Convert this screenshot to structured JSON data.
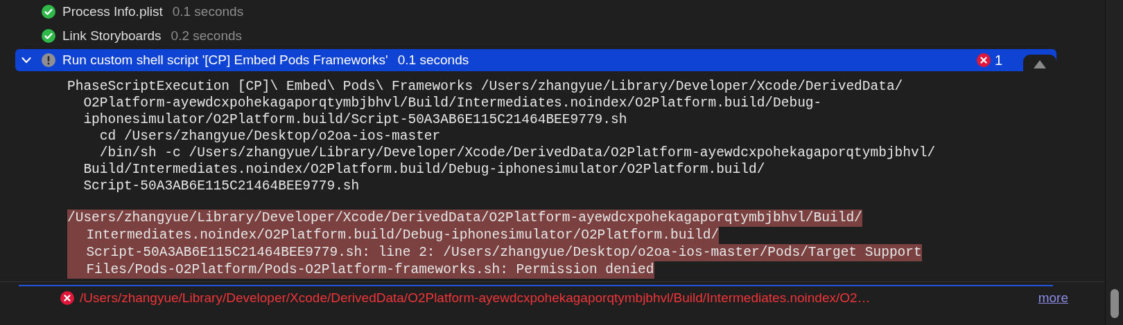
{
  "steps": [
    {
      "label": "Process Info.plist",
      "duration": "0.1 seconds",
      "kind": "success",
      "selected": false
    },
    {
      "label": "Link Storyboards",
      "duration": "0.2 seconds",
      "kind": "success",
      "selected": false
    },
    {
      "label": "Run custom shell script '[CP] Embed Pods Frameworks'",
      "duration": "0.1 seconds",
      "kind": "warning",
      "selected": true,
      "expanded": true,
      "error_count": "1"
    }
  ],
  "command_output": [
    {
      "kind": "command",
      "text": "PhaseScriptExecution [CP]\\ Embed\\ Pods\\ Frameworks /Users/zhangyue/Library/Developer/Xcode/DerivedData/"
    },
    {
      "kind": "continuation",
      "text": "O2Platform-ayewdcxpohekagaporqtymbjbhvl/Build/Intermediates.noindex/O2Platform.build/Debug-"
    },
    {
      "kind": "continuation",
      "text": "iphonesimulator/O2Platform.build/Script-50A3AB6E115C21464BEE9779.sh"
    },
    {
      "kind": "subcommand",
      "text": "cd /Users/zhangyue/Desktop/o2oa-ios-master"
    },
    {
      "kind": "subcommand",
      "text": "/bin/sh -c /Users/zhangyue/Library/Developer/Xcode/DerivedData/O2Platform-ayewdcxpohekagaporqtymbjbhvl/"
    },
    {
      "kind": "continuation",
      "text": "Build/Intermediates.noindex/O2Platform.build/Debug-iphonesimulator/O2Platform.build/"
    },
    {
      "kind": "continuation",
      "text": "Script-50A3AB6E115C21464BEE9779.sh"
    }
  ],
  "error_output": [
    {
      "kind": "command",
      "text": "/Users/zhangyue/Library/Developer/Xcode/DerivedData/O2Platform-ayewdcxpohekagaporqtymbjbhvl/Build/"
    },
    {
      "kind": "continuation",
      "text": "Intermediates.noindex/O2Platform.build/Debug-iphonesimulator/O2Platform.build/"
    },
    {
      "kind": "continuation",
      "text": "Script-50A3AB6E115C21464BEE9779.sh: line 2: /Users/zhangyue/Desktop/o2oa-ios-master/Pods/Target Support"
    },
    {
      "kind": "continuation",
      "text": "Files/Pods-O2Platform/Pods-O2Platform-frameworks.sh: Permission denied"
    }
  ],
  "issue": {
    "kind": "error",
    "message": "/Users/zhangyue/Library/Developer/Xcode/DerivedData/O2Platform-ayewdcxpohekagaporqtymbjbhvl/Build/Intermediates.noindex/O2…",
    "link": "more"
  }
}
